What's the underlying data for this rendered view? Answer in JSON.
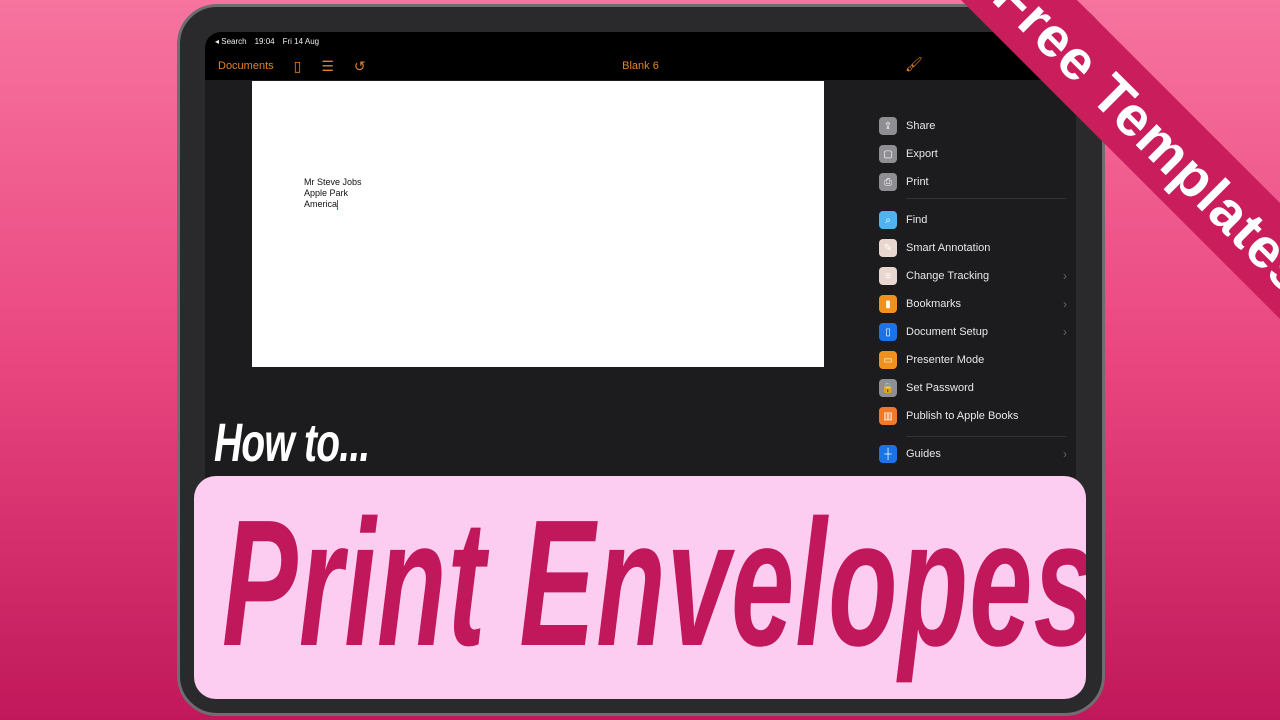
{
  "status": {
    "back": "◂ Search",
    "time": "19:04",
    "date": "Fri 14 Aug"
  },
  "toolbar": {
    "documents": "Documents",
    "title": "Blank 6",
    "icons": [
      "sidebar-icon",
      "list-icon",
      "undo-icon",
      "paintbrush-icon"
    ]
  },
  "document": {
    "lines": [
      "Mr Steve Jobs",
      "Apple Park",
      "America"
    ]
  },
  "menu": {
    "items": [
      {
        "label": "Share",
        "icon": "share-icon",
        "color": "#8e8e93"
      },
      {
        "label": "Export",
        "icon": "export-icon",
        "color": "#8e8e93"
      },
      {
        "label": "Print",
        "icon": "printer-icon",
        "color": "#8e8e93"
      },
      {
        "label": "Find",
        "icon": "search-icon",
        "color": "#4fb3f0"
      },
      {
        "label": "Smart Annotation",
        "icon": "annotation-icon",
        "color": "#e9d6cf"
      },
      {
        "label": "Change Tracking",
        "icon": "tracking-icon",
        "color": "#e9d6cf",
        "chevron": true
      },
      {
        "label": "Bookmarks",
        "icon": "bookmark-icon",
        "color": "#f0901d",
        "chevron": true
      },
      {
        "label": "Document Setup",
        "icon": "document-icon",
        "color": "#1a74e8",
        "chevron": true
      },
      {
        "label": "Presenter Mode",
        "icon": "presenter-icon",
        "color": "#f0901d"
      },
      {
        "label": "Set Password",
        "icon": "lock-icon",
        "color": "#8e8e93"
      },
      {
        "label": "Publish to Apple Books",
        "icon": "book-icon",
        "color": "#f07a2a"
      },
      {
        "label": "Guides",
        "icon": "guides-icon",
        "color": "#1a74e8",
        "chevron": true
      }
    ]
  },
  "overlay": {
    "ribbon": "Free Templates!",
    "howto": "How to...",
    "headline": "Print Envelopes"
  }
}
